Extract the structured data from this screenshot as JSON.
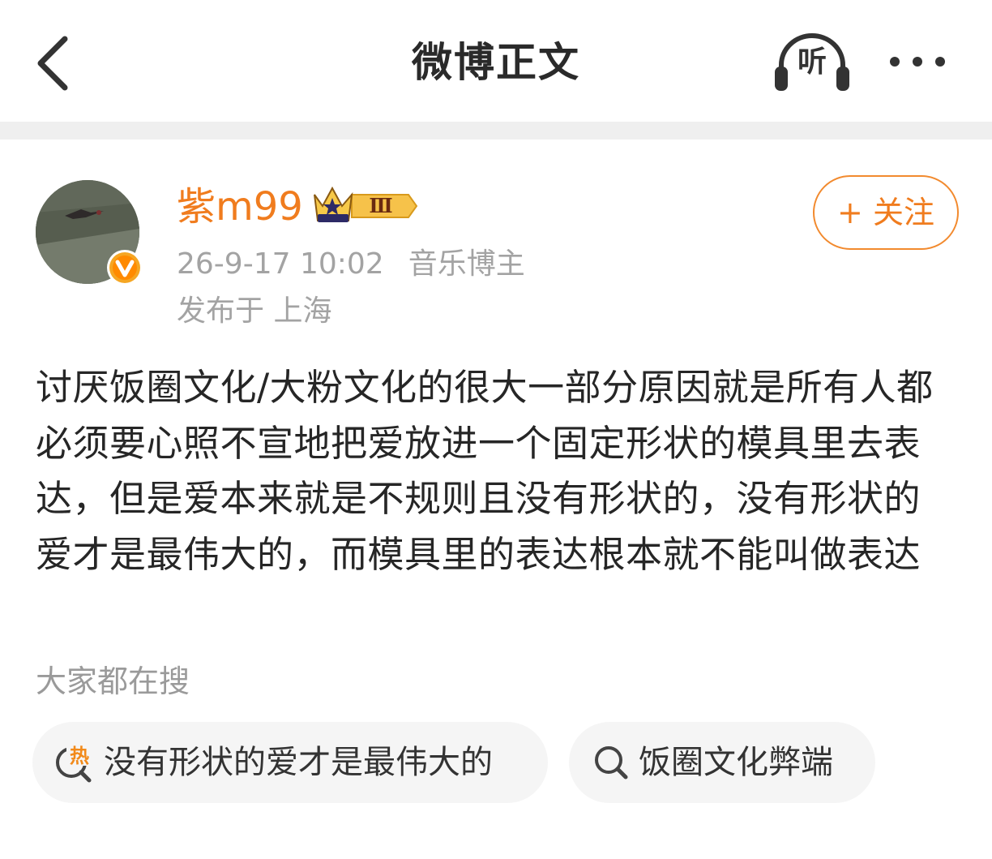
{
  "nav": {
    "title": "微博正文",
    "listen_label": "听"
  },
  "author": {
    "name": "紫m99",
    "vip_level": "Ⅲ",
    "timestamp": "26-9-17 10:02",
    "category": "音乐博主",
    "location": "发布于 上海",
    "follow_label": "+ 关注"
  },
  "post": {
    "text": "讨厌饭圈文化/大粉文化的很大一部分原因就是所有人都必须要心照不宣地把爱放进一个固定形状的模具里去表达，但是爱本来就是不规则且没有形状的，没有形状的爱才是最伟大的，而模具里的表达根本就不能叫做表达"
  },
  "trending": {
    "heading": "大家都在搜",
    "items": [
      {
        "label": "没有形状的爱才是最伟大的",
        "icon": "hot-search-icon",
        "hot_mark": "热"
      },
      {
        "label": "饭圈文化弊端",
        "icon": "search-icon"
      }
    ]
  },
  "colors": {
    "accent_orange": "#f07c1e",
    "muted_text": "#a3a3a3",
    "body_text": "#262626",
    "chip_bg": "#f5f5f5"
  }
}
